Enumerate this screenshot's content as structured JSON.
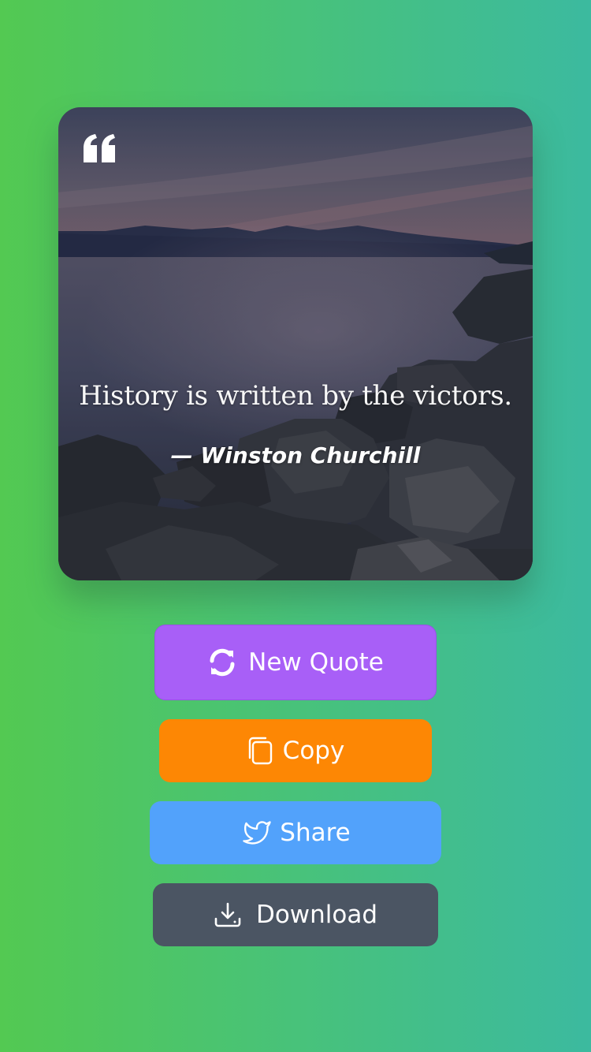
{
  "quote": {
    "text": "History is written by the victors.",
    "author": "— Winston Churchill"
  },
  "icons": {
    "quote": "quote-left-icon",
    "new_quote": "refresh-icon",
    "copy": "copy-icon",
    "share": "twitter-icon",
    "download": "download-icon"
  },
  "buttons": {
    "new_quote": "New Quote",
    "copy": "Copy",
    "share": "Share",
    "download": "Download"
  },
  "colors": {
    "background_start": "#53c952",
    "background_end": "#3cba9f",
    "new_quote": "#a85ff7",
    "copy": "#fd8704",
    "share": "#52a2fb",
    "download": "#4b5563"
  }
}
